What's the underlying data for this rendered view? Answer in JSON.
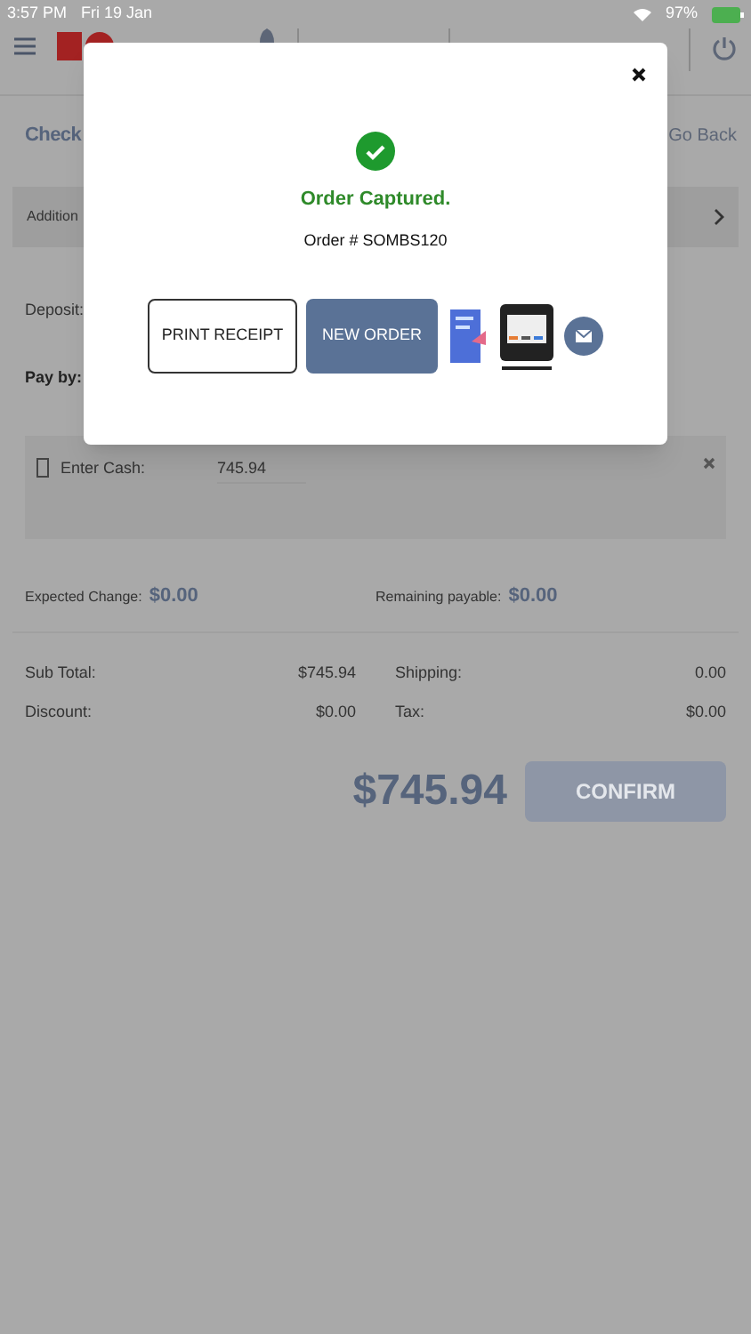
{
  "status_bar": {
    "time": "3:57 PM",
    "date": "Fri 19 Jan",
    "battery": "97%"
  },
  "page": {
    "title": "Check",
    "back": "Go Back",
    "section": "Addition",
    "deposit_label": "Deposit:",
    "pay_by": "Pay by:",
    "cash": {
      "label": "Enter Cash:",
      "value": "745.94"
    },
    "expected_change": {
      "label": "Expected Change:",
      "value": "$0.00"
    },
    "remaining": {
      "label": "Remaining payable:",
      "value": "$0.00"
    },
    "totals": [
      {
        "label": "Sub Total:",
        "value": "$745.94"
      },
      {
        "label": "Shipping:",
        "value": "0.00"
      },
      {
        "label": "Discount:",
        "value": "$0.00"
      },
      {
        "label": "Tax:",
        "value": "$0.00"
      }
    ],
    "grand_total": "$745.94",
    "confirm": {
      "label": "CONFIRM",
      "disabled": true
    }
  },
  "dialog": {
    "title": "Order Captured.",
    "order": "Order # SOMBS120",
    "buttons": [
      {
        "label": "PRINT RECEIPT",
        "kind": "outline"
      },
      {
        "label": "NEW ORDER",
        "kind": "filled"
      }
    ]
  }
}
